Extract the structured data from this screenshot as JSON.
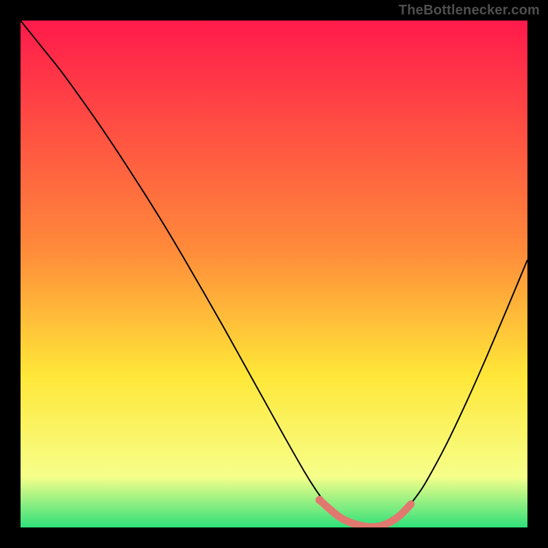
{
  "watermark": "TheBottlenecker.com",
  "colors": {
    "bg": "#000000",
    "watermark": "#4f4f4f",
    "curve": "#000000",
    "highlight": "#e0786f",
    "gradient_top": "#ff1a4b",
    "gradient_mid1": "#ff8a3a",
    "gradient_mid2": "#ffe738",
    "gradient_mid3": "#f6ff8a",
    "gradient_bottom": "#2fe07a"
  },
  "chart_data": {
    "type": "line",
    "title": "",
    "xlabel": "",
    "ylabel": "",
    "xlim": [
      0,
      100
    ],
    "ylim": [
      0,
      100
    ],
    "series": [
      {
        "name": "bottleneck-curve",
        "x": [
          0,
          4,
          8,
          12,
          16,
          20,
          24,
          28,
          32,
          36,
          40,
          44,
          48,
          52,
          56,
          58,
          60,
          62,
          64,
          66,
          68,
          70,
          72,
          74,
          76,
          78,
          80,
          84,
          88,
          92,
          96,
          100
        ],
        "y": [
          100,
          95,
          90,
          84.5,
          78.8,
          72.8,
          66.6,
          60.2,
          53.5,
          46.6,
          39.6,
          32.4,
          25.2,
          18,
          11,
          7.8,
          5,
          2.8,
          1.4,
          0.6,
          0.2,
          0.2,
          0.7,
          1.8,
          3.6,
          6,
          9,
          16.4,
          24.8,
          33.8,
          43.2,
          52.8
        ]
      }
    ],
    "highlight": {
      "name": "optimal-zone",
      "x": [
        59,
        61,
        63,
        65,
        67,
        69,
        71,
        73,
        75,
        77
      ],
      "y": [
        5.4,
        3.6,
        2.0,
        1.0,
        0.4,
        0.1,
        0.3,
        1.1,
        2.5,
        4.6
      ]
    }
  }
}
